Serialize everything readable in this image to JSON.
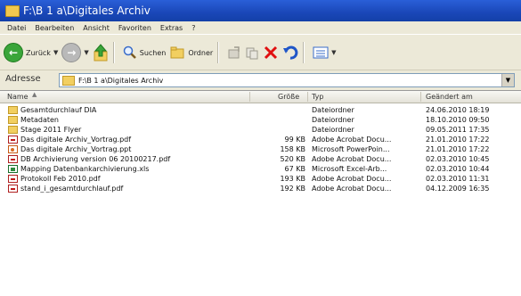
{
  "window": {
    "title": "F:\\B 1 a\\Digitales Archiv"
  },
  "menu": [
    "Datei",
    "Bearbeiten",
    "Ansicht",
    "Favoriten",
    "Extras",
    "?"
  ],
  "toolbar": {
    "back_label": "Zurück",
    "search_label": "Suchen",
    "folders_label": "Ordner"
  },
  "address": {
    "label": "Adresse",
    "value": "F:\\B 1 a\\Digitales Archiv"
  },
  "columns": {
    "name": "Name",
    "size": "Größe",
    "type": "Typ",
    "modified": "Geändert am"
  },
  "files": [
    {
      "icon": "folder",
      "name": "Gesamtdurchlauf DIA",
      "size": "",
      "type": "Dateiordner",
      "modified": "24.06.2010 18:19"
    },
    {
      "icon": "folder",
      "name": "Metadaten",
      "size": "",
      "type": "Dateiordner",
      "modified": "18.10.2010 09:50"
    },
    {
      "icon": "folder",
      "name": "Stage 2011 Flyer",
      "size": "",
      "type": "Dateiordner",
      "modified": "09.05.2011 17:35"
    },
    {
      "icon": "pdf",
      "name": "Das digitale Archiv_Vortrag.pdf",
      "size": "99 KB",
      "type": "Adobe Acrobat Docu...",
      "modified": "21.01.2010 17:22"
    },
    {
      "icon": "ppt",
      "name": "Das digitale Archiv_Vortrag.ppt",
      "size": "158 KB",
      "type": "Microsoft PowerPoin...",
      "modified": "21.01.2010 17:22"
    },
    {
      "icon": "pdf",
      "name": "DB Archivierung version 06 20100217.pdf",
      "size": "520 KB",
      "type": "Adobe Acrobat Docu...",
      "modified": "02.03.2010 10:45"
    },
    {
      "icon": "xls",
      "name": "Mapping Datenbankarchivierung.xls",
      "size": "67 KB",
      "type": "Microsoft Excel-Arb...",
      "modified": "02.03.2010 10:44"
    },
    {
      "icon": "pdf",
      "name": "Protokoll Feb 2010.pdf",
      "size": "193 KB",
      "type": "Adobe Acrobat Docu...",
      "modified": "02.03.2010 11:31"
    },
    {
      "icon": "pdf",
      "name": "stand_i_gesamtdurchlauf.pdf",
      "size": "192 KB",
      "type": "Adobe Acrobat Docu...",
      "modified": "04.12.2009 16:35"
    }
  ]
}
